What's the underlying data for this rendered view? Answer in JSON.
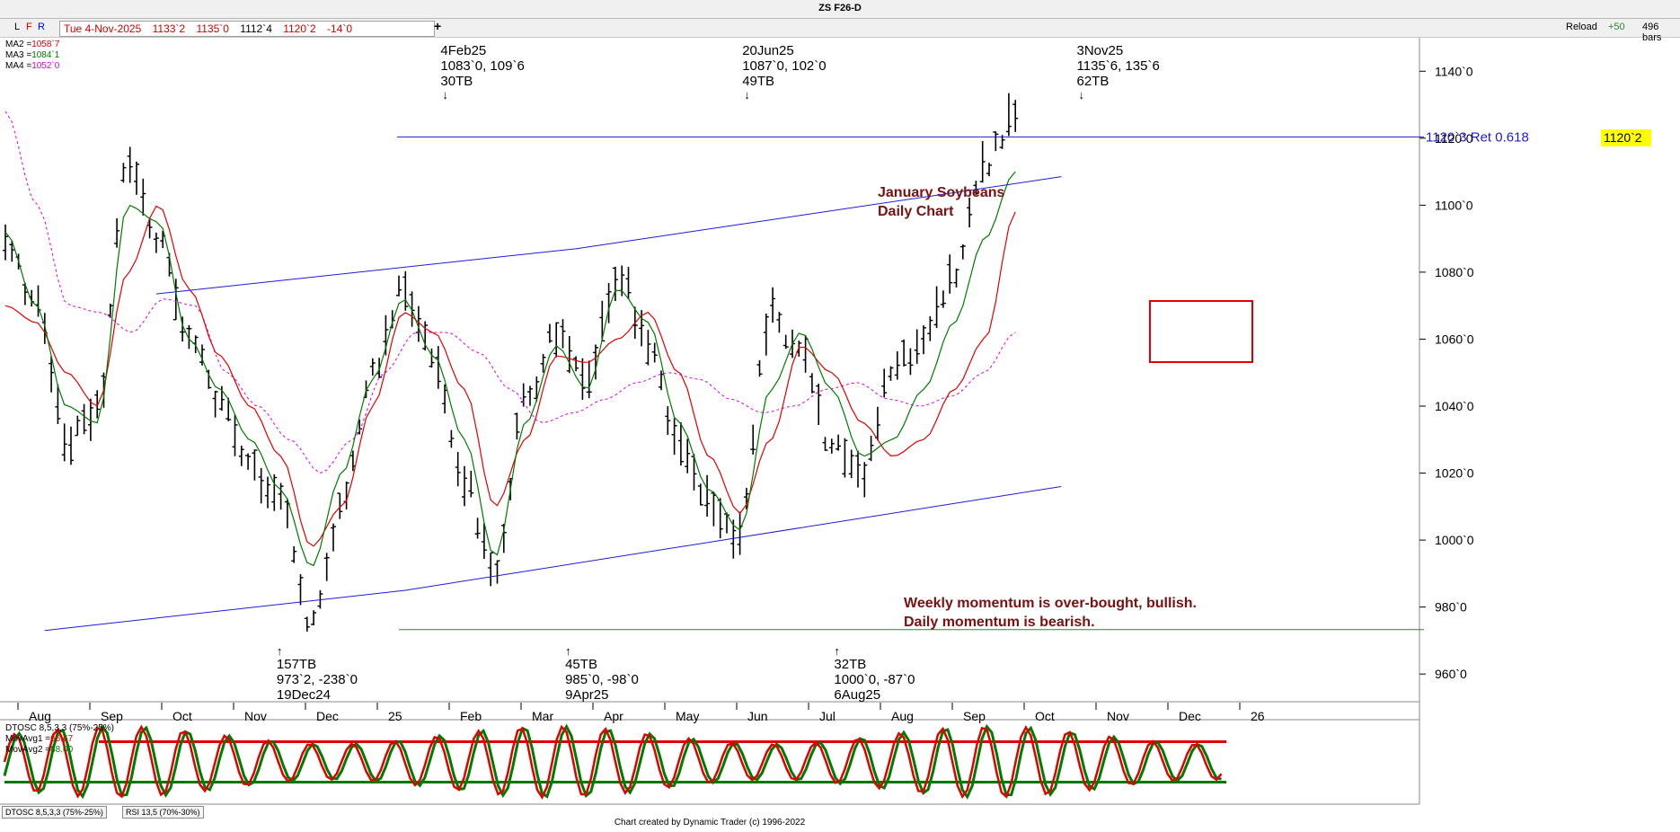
{
  "window": {
    "title": "ZS F26-D"
  },
  "toolbar": {
    "letters": [
      "L",
      "F",
      "R"
    ],
    "date": "Tue 4-Nov-2025",
    "values": [
      "1133`2",
      "1135`0",
      "1112`4",
      "1120`2",
      "-14`0"
    ],
    "plus": "+",
    "reload": "Reload",
    "plus_count": "+50",
    "bar_count": "496 bars"
  },
  "moving_averages": [
    {
      "label": "MA2 =",
      "value": "1058`7",
      "color": "#e00000"
    },
    {
      "label": "MA3 =",
      "value": "1084`1",
      "color": "#007a00"
    },
    {
      "label": "MA4 =",
      "value": "1052`0",
      "color": "#e000e0"
    }
  ],
  "oscillator": {
    "legend": [
      {
        "text": "DTOSC 8,5,3,3 (75%-25%)",
        "color": "#000000"
      },
      {
        "text": "MovAvg1 =",
        "value": "66.67",
        "color": "#e00000"
      },
      {
        "text": "MovAvg2 =",
        "value": "88.00",
        "color": "#007a00"
      }
    ],
    "upper": 75,
    "lower": 25
  },
  "tabs": [
    "DTOSC 8,5,3,3 (75%-25%)",
    "RSI 13,5 (70%-30%)"
  ],
  "footer": "Chart created by Dynamic Trader  (c)  1996-2022",
  "chart_data": {
    "type": "ohlc",
    "symbol": "ZS F26-D",
    "ylim": [
      952,
      1150
    ],
    "y_ticks": [
      {
        "v": 1140,
        "label": "1140`0"
      },
      {
        "v": 1120,
        "label": "1120`0"
      },
      {
        "v": 1100,
        "label": "1100`0"
      },
      {
        "v": 1080,
        "label": "1080`0"
      },
      {
        "v": 1060,
        "label": "1060`0"
      },
      {
        "v": 1040,
        "label": "1040`0"
      },
      {
        "v": 1020,
        "label": "1020`0"
      },
      {
        "v": 1000,
        "label": "1000`0"
      },
      {
        "v": 980,
        "label": "980`0"
      },
      {
        "v": 960,
        "label": "960`0"
      }
    ],
    "x_labels": [
      "Aug",
      "Sep",
      "Oct",
      "Nov",
      "Dec",
      "25",
      "Feb",
      "Mar",
      "Apr",
      "May",
      "Jun",
      "Jul",
      "Aug",
      "Sep",
      "Oct",
      "Nov",
      "Dec",
      "26"
    ],
    "price_anchors": [
      1088,
      1070,
      1030,
      1038,
      1112,
      1090,
      1062,
      1040,
      1022,
      1012,
      975,
      1010,
      1050,
      1075,
      1055,
      1018,
      988,
      1042,
      1062,
      1045,
      1080,
      1060,
      1028,
      1010,
      1002,
      1068,
      1055,
      1028,
      1020,
      1050,
      1060,
      1080,
      1112,
      1128
    ],
    "ma2": [
      1070,
      1065,
      1050,
      1040,
      1080,
      1100,
      1075,
      1055,
      1040,
      1025,
      998,
      1010,
      1040,
      1068,
      1062,
      1045,
      1010,
      1030,
      1055,
      1053,
      1060,
      1068,
      1050,
      1025,
      1008,
      1030,
      1058,
      1050,
      1035,
      1025,
      1030,
      1045,
      1060,
      1098
    ],
    "ma3": [
      1092,
      1070,
      1040,
      1035,
      1100,
      1095,
      1060,
      1045,
      1030,
      1015,
      992,
      1020,
      1048,
      1072,
      1055,
      1030,
      995,
      1035,
      1058,
      1045,
      1075,
      1065,
      1035,
      1015,
      1003,
      1045,
      1062,
      1045,
      1025,
      1030,
      1045,
      1065,
      1090,
      1110
    ],
    "ma4": [
      1128,
      1100,
      1070,
      1068,
      1062,
      1072,
      1070,
      1050,
      1040,
      1030,
      1020,
      1030,
      1050,
      1062,
      1062,
      1056,
      1045,
      1035,
      1038,
      1042,
      1047,
      1050,
      1048,
      1042,
      1038,
      1040,
      1045,
      1047,
      1042,
      1040,
      1043,
      1050,
      1062
    ],
    "price_last": {
      "value": 1120.25,
      "label": "1120`2"
    },
    "retracement": {
      "value": 1120.375,
      "label": "1120`3 Ret 0.618"
    },
    "support_level": 973.25,
    "trend_upper": [
      {
        "x": 62,
        "y": 1073.5
      },
      {
        "x": 126,
        "y": 1087
      },
      {
        "x": 200,
        "y": 1108.5
      }
    ],
    "trend_lower": [
      {
        "x": 45,
        "y": 973
      },
      {
        "x": 100,
        "y": 985
      },
      {
        "x": 200,
        "y": 1016
      }
    ],
    "annotations": [
      {
        "id": "ann-4feb25",
        "x": 68,
        "lines": [
          "4Feb25",
          "1083`0, 109`6",
          "30TB"
        ],
        "pos": "top",
        "arrow": "↓"
      },
      {
        "id": "ann-20jun25",
        "x": 114,
        "lines": [
          "20Jun25",
          "1087`0, 102`0",
          "49TB"
        ],
        "pos": "top",
        "arrow": "↓"
      },
      {
        "id": "ann-3nov25",
        "x": 165,
        "lines": [
          "3Nov25",
          "1135`6, 135`6",
          "62TB"
        ],
        "pos": "top",
        "arrow": "↓"
      },
      {
        "id": "ann-19dec24",
        "x": 43,
        "lines": [
          "157TB",
          "973`2, -238`0",
          "19Dec24"
        ],
        "pos": "bottom",
        "arrow": "↑"
      },
      {
        "id": "ann-9apr25",
        "x": 87,
        "lines": [
          "45TB",
          "985`0, -98`0",
          "9Apr25"
        ],
        "pos": "bottom",
        "arrow": "↑"
      },
      {
        "id": "ann-6aug25",
        "x": 128,
        "lines": [
          "32TB",
          "1000`0, -87`0",
          "6Aug25"
        ],
        "pos": "bottom",
        "arrow": "↑"
      }
    ],
    "title_text": [
      "January Soybeans",
      "Daily Chart"
    ],
    "note_text": [
      "Weekly momentum is over-bought, bullish.",
      "Daily momentum is bearish."
    ]
  },
  "colors": {
    "ma2": "#e00000",
    "ma3": "#007a00",
    "ma4": "#e000e0",
    "trend": "#1c1cd8",
    "retracement": "#1c1cd8",
    "support": "#2a8a2a",
    "price_label_bg": "#ffff00",
    "annotation_text": "#7a1010",
    "highlight_box": "#e00000"
  }
}
